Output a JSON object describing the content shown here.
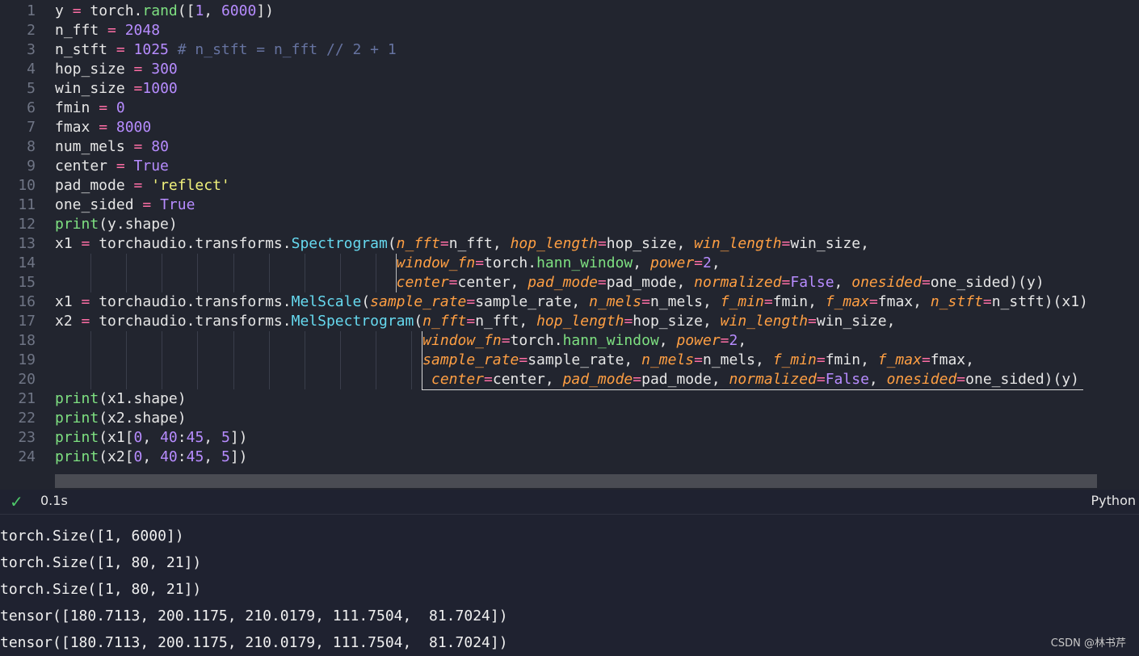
{
  "editor": {
    "lines": [
      {
        "n": "1",
        "html": "y <span class=\"op\">=</span> torch.<span class=\"fn\">rand</span>([<span class=\"num\">1</span>, <span class=\"num\">6000</span>])"
      },
      {
        "n": "2",
        "html": "n_fft <span class=\"op\">=</span> <span class=\"num\">2048</span>"
      },
      {
        "n": "3",
        "html": "n_stft <span class=\"op\">=</span> <span class=\"num\">1025</span> <span class=\"cm\"># n_stft = n_fft // 2 + 1</span>"
      },
      {
        "n": "4",
        "html": "hop_size <span class=\"op\">=</span> <span class=\"num\">300</span>"
      },
      {
        "n": "5",
        "html": "win_size <span class=\"op\">=</span><span class=\"num\">1000</span>"
      },
      {
        "n": "6",
        "html": "fmin <span class=\"op\">=</span> <span class=\"num\">0</span>"
      },
      {
        "n": "7",
        "html": "fmax <span class=\"op\">=</span> <span class=\"num\">8000</span>"
      },
      {
        "n": "8",
        "html": "num_mels <span class=\"op\">=</span> <span class=\"num\">80</span>"
      },
      {
        "n": "9",
        "html": "center <span class=\"op\">=</span> <span class=\"tru\">True</span>"
      },
      {
        "n": "10",
        "html": "pad_mode <span class=\"op\">=</span> <span class=\"str\">'reflect'</span>"
      },
      {
        "n": "11",
        "html": "one_sided <span class=\"op\">=</span> <span class=\"tru\">True</span>"
      },
      {
        "n": "12",
        "html": "<span class=\"fn\">print</span>(y.shape)"
      },
      {
        "n": "13",
        "html": "x1 <span class=\"op\">=</span> torchaudio.transforms.<span class=\"cls\">Spectrogram</span>(<span class=\"arg\">n_fft</span><span class=\"op\">=</span>n_fft, <span class=\"arg\">hop_length</span><span class=\"op\">=</span>hop_size, <span class=\"arg\">win_length</span><span class=\"op\">=</span>win_size,"
      },
      {
        "n": "14",
        "html": "                                       <span class=\"arg\">window_fn</span><span class=\"op\">=</span>torch.<span class=\"fn\">hann_window</span>, <span class=\"arg\">power</span><span class=\"op\">=</span><span class=\"num\">2</span>,"
      },
      {
        "n": "15",
        "html": "                                       <span class=\"arg\">center</span><span class=\"op\">=</span>center, <span class=\"arg\">pad_mode</span><span class=\"op\">=</span>pad_mode, <span class=\"arg\">normalized</span><span class=\"op\">=</span><span class=\"tru\">False</span>, <span class=\"arg\">onesided</span><span class=\"op\">=</span>one_sided)(y)"
      },
      {
        "n": "16",
        "html": "x1 <span class=\"op\">=</span> torchaudio.transforms.<span class=\"cls\">MelScale</span>(<span class=\"arg\">sample_rate</span><span class=\"op\">=</span>sample_rate, <span class=\"arg\">n_mels</span><span class=\"op\">=</span>n_mels, <span class=\"arg\">f_min</span><span class=\"op\">=</span>fmin, <span class=\"arg\">f_max</span><span class=\"op\">=</span>fmax, <span class=\"arg\">n_stft</span><span class=\"op\">=</span>n_stft)(x1)"
      },
      {
        "n": "17",
        "html": "x2 <span class=\"op\">=</span> torchaudio.transforms.<span class=\"cls\">MelSpectrogram</span>(<span class=\"arg\">n_fft</span><span class=\"op\">=</span>n_fft, <span class=\"arg\">hop_length</span><span class=\"op\">=</span>hop_size, <span class=\"arg\">win_length</span><span class=\"op\">=</span>win_size,"
      },
      {
        "n": "18",
        "html": "                                          <span class=\"arg\">window_fn</span><span class=\"op\">=</span>torch.<span class=\"fn\">hann_window</span>, <span class=\"arg\">power</span><span class=\"op\">=</span><span class=\"num\">2</span>,"
      },
      {
        "n": "19",
        "html": "                                          <span class=\"arg\">sample_rate</span><span class=\"op\">=</span>sample_rate, <span class=\"arg\">n_mels</span><span class=\"op\">=</span>n_mels, <span class=\"arg\">f_min</span><span class=\"op\">=</span>fmin, <span class=\"arg\">f_max</span><span class=\"op\">=</span>fmax,"
      },
      {
        "n": "20",
        "html": "                                           <span class=\"arg\">center</span><span class=\"op\">=</span>center, <span class=\"arg\">pad_mode</span><span class=\"op\">=</span>pad_mode, <span class=\"arg\">normalized</span><span class=\"op\">=</span><span class=\"tru\">False</span>, <span class=\"arg\">onesided</span><span class=\"op\">=</span>one_sided)(y)"
      },
      {
        "n": "21",
        "html": "<span class=\"fn\">print</span>(x1.shape)"
      },
      {
        "n": "22",
        "html": "<span class=\"fn\">print</span>(x2.shape)"
      },
      {
        "n": "23",
        "html": "<span class=\"fn\">print</span>(x1[<span class=\"num\">0</span>, <span class=\"num\">40</span>:<span class=\"num\">45</span>, <span class=\"num\">5</span>])"
      },
      {
        "n": "24",
        "html": "<span class=\"fn\">print</span>(x2[<span class=\"num\">0</span>, <span class=\"num\">40</span>:<span class=\"num\">45</span>, <span class=\"num\">5</span>])"
      }
    ]
  },
  "status": {
    "check_icon": "check-icon",
    "exec_time": "0.1s",
    "language": "Python"
  },
  "output": {
    "lines": [
      "torch.Size([1, 6000])",
      "torch.Size([1, 80, 21])",
      "torch.Size([1, 80, 21])",
      "tensor([180.7113, 200.1175, 210.0179, 111.7504,  81.7024])",
      "tensor([180.7113, 200.1175, 210.0179, 111.7504,  81.7024])"
    ]
  },
  "watermark": "CSDN @林书芹"
}
